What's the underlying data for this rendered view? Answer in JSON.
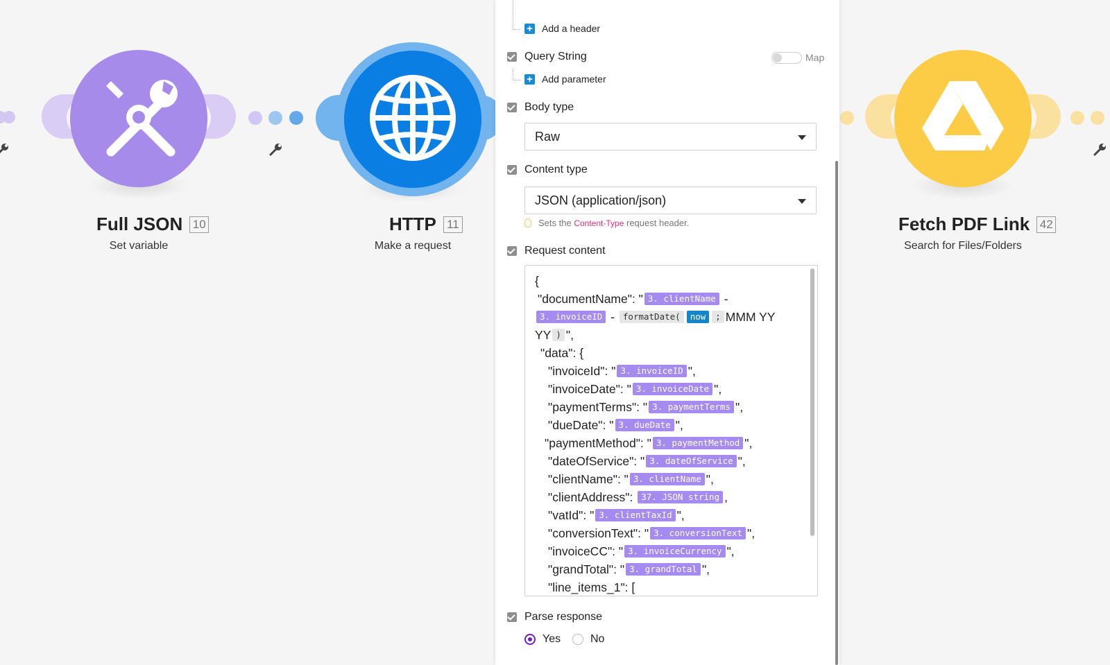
{
  "modules": [
    {
      "title": "Full JSON",
      "badge": "10",
      "subtitle": "Set variable",
      "icon": "tools-icon",
      "color": "#a78bea"
    },
    {
      "title": "HTTP",
      "badge": "11",
      "subtitle": "Make a request",
      "icon": "globe-icon",
      "color": "#0a7ee3"
    },
    {
      "title": "Fetch PDF Link",
      "badge": "42",
      "subtitle": "Search for Files/Folders",
      "icon": "google-drive-icon",
      "color": "#fccc47"
    }
  ],
  "panel": {
    "add_header": "Add a header",
    "query_string": {
      "label": "Query String",
      "map_label": "Map"
    },
    "add_parameter": "Add parameter",
    "body_type": {
      "label": "Body type",
      "value": "Raw"
    },
    "content_type": {
      "label": "Content type",
      "value": "JSON (application/json)"
    },
    "hint": {
      "prefix": "Sets the",
      "highlight": "Content-Type",
      "suffix": "request header."
    },
    "request_content": {
      "label": "Request content",
      "tokens": {
        "clientName": "3. clientName",
        "invoiceID": "3. invoiceID",
        "formatDate": "formatDate(",
        "now": "now",
        "semicolon": ";",
        "close_paren": ")",
        "invoiceDate": "3. invoiceDate",
        "paymentTerms": "3. paymentTerms",
        "dueDate": "3. dueDate",
        "paymentMethod": "3. paymentMethod",
        "dateOfService": "3. dateOfService",
        "jsonString": "37. JSON string",
        "clientTaxId": "3. clientTaxId",
        "conversionText": "3. conversionText",
        "invoiceCurrency": "3. invoiceCurrency",
        "grandTotal": "3. grandTotal"
      },
      "text": {
        "open_brace": "{",
        "documentName_key": "\"documentName\": \"",
        "dash": "-",
        "mmm_yy": "MMM YY",
        "yy": "YY",
        "quote_comma": "\",",
        "comma": ",",
        "data_key": "\"data\": {",
        "invoiceId_key": "\"invoiceId\": \"",
        "invoiceDate_key": "\"invoiceDate\": \"",
        "paymentTerms_key": "\"paymentTerms\": \"",
        "dueDate_key": "\"dueDate\": \"",
        "paymentMethod_key": "\"paymentMethod\": \"",
        "dateOfService_key": "\"dateOfService\": \"",
        "clientName_key": "\"clientName\": \"",
        "clientAddress_key": "\"clientAddress\":",
        "vatId_key": "\"vatId\": \"",
        "conversionText_key": "\"conversionText\": \"",
        "invoiceCC_key": "\"invoiceCC\": \"",
        "grandTotal_key": "\"grandTotal\": \"",
        "line_items_key": "\"line_items_1\": ["
      }
    },
    "parse_response": {
      "label": "Parse response",
      "yes": "Yes",
      "no": "No",
      "selected": "Yes"
    }
  }
}
